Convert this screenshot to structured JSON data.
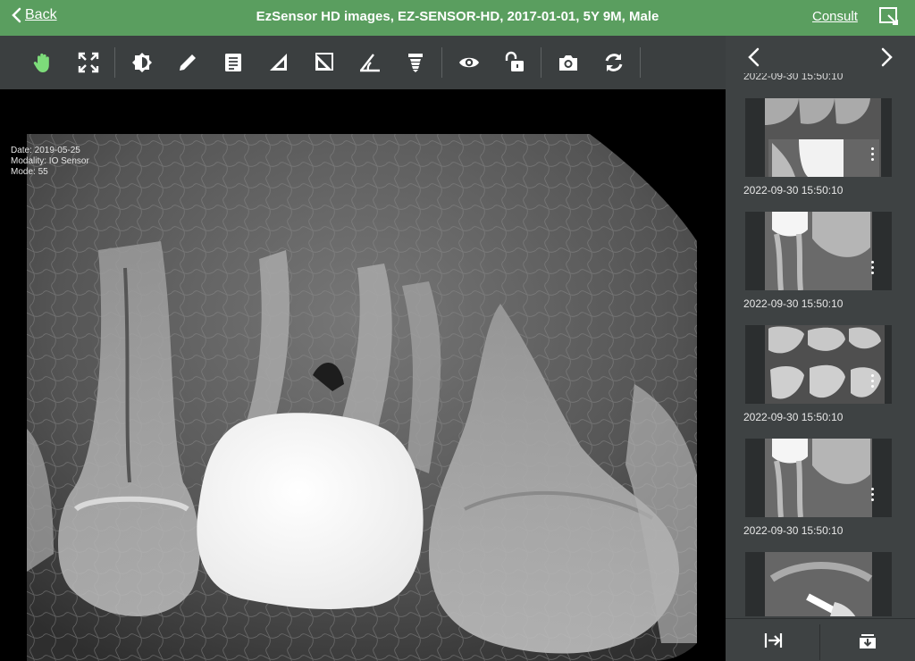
{
  "header": {
    "back_label": "Back",
    "title": "EzSensor HD images, EZ-SENSOR-HD, 2017-01-01, 5Y 9M, Male",
    "consult_label": "Consult"
  },
  "toolbar": {
    "tools": [
      "hand-icon",
      "fit-screen-icon",
      "brightness-contrast-icon",
      "pencil-icon",
      "report-icon",
      "ruler-triangle-icon",
      "angle-measure-icon",
      "protractor-icon",
      "implant-icon",
      "eye-icon",
      "unlock-icon",
      "camera-icon",
      "rotate-icon"
    ],
    "active_tool": "hand-icon",
    "active_color": "#7ddc7a"
  },
  "viewer": {
    "info_date": "Date: 2019-05-25",
    "info_modality": "Modality: IO Sensor",
    "info_mode": "Mode: 55"
  },
  "thumbnails": {
    "cut_label": "2022-09-30 15:50:10",
    "items": [
      {
        "label": "2022-09-30 15:50:10"
      },
      {
        "label": "2022-09-30 15:50:10"
      },
      {
        "label": "2022-09-30 15:50:10"
      },
      {
        "label": "2022-09-30 15:50:10"
      }
    ]
  },
  "colors": {
    "header_green": "#5a9e5f",
    "toolbar_bg": "#3b3f40",
    "panel_bg": "#3e4243"
  }
}
